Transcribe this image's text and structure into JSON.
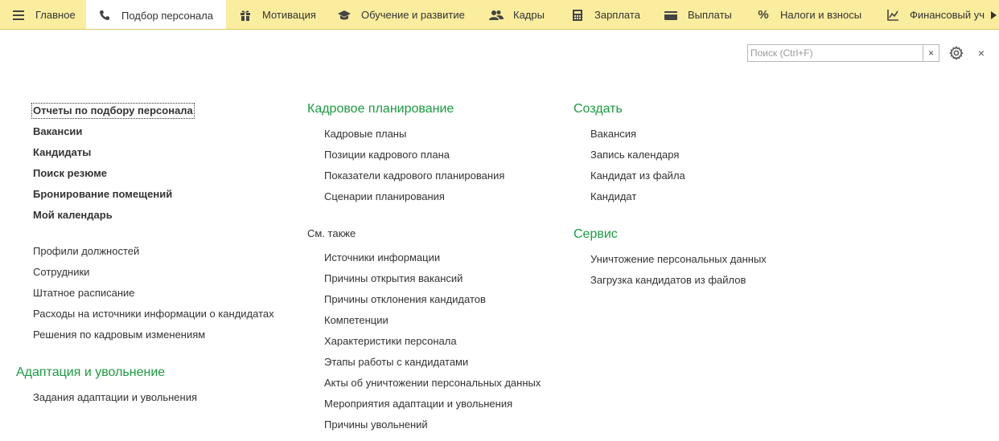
{
  "tabs": [
    {
      "label": "Главное",
      "icon": "hamburger-icon"
    },
    {
      "label": "Подбор персонала",
      "icon": "phone-icon"
    },
    {
      "label": "Мотивация",
      "icon": "gift-icon"
    },
    {
      "label": "Обучение и развитие",
      "icon": "graduation-cap-icon"
    },
    {
      "label": "Кадры",
      "icon": "people-icon"
    },
    {
      "label": "Зарплата",
      "icon": "calculator-icon"
    },
    {
      "label": "Выплаты",
      "icon": "wallet-icon"
    },
    {
      "label": "Налоги и взносы",
      "icon": "percent-icon"
    },
    {
      "label": "Финансовый уч",
      "icon": "chart-axis-icon"
    }
  ],
  "search": {
    "placeholder": "Поиск (Ctrl+F)",
    "value": "",
    "clear_glyph": "×"
  },
  "window": {
    "close_glyph": "×"
  },
  "left": {
    "bold_links": [
      "Отчеты по подбору персонала",
      "Вакансии",
      "Кандидаты",
      "Поиск резюме",
      "Бронирование помещений",
      "Мой календарь"
    ],
    "links": [
      "Профили должностей",
      "Сотрудники",
      "Штатное расписание",
      "Расходы на источники информации о кандидатах",
      "Решения по кадровым изменениям"
    ],
    "adaptation": {
      "title": "Адаптация и увольнение",
      "links": [
        "Задания адаптации и увольнения"
      ]
    }
  },
  "middle": {
    "planning": {
      "title": "Кадровое планирование",
      "links": [
        "Кадровые планы",
        "Позиции кадрового плана",
        "Показатели кадрового планирования",
        "Сценарии планирования"
      ]
    },
    "see_also": {
      "title": "См. также",
      "links": [
        "Источники информации",
        "Причины открытия вакансий",
        "Причины отклонения кандидатов",
        "Компетенции",
        "Характеристики персонала",
        "Этапы работы с кандидатами",
        "Акты об уничтожении персональных данных",
        "Мероприятия адаптации и увольнения",
        "Причины увольнений"
      ]
    }
  },
  "right": {
    "create": {
      "title": "Создать",
      "links": [
        "Вакансия",
        "Запись календаря",
        "Кандидат из файла",
        "Кандидат"
      ]
    },
    "service": {
      "title": "Сервис",
      "links": [
        "Уничтожение персональных данных",
        "Загрузка кандидатов из файлов"
      ]
    }
  },
  "colors": {
    "accent_green": "#1a9c3f",
    "topbar": "#fbed9e",
    "text": "#333333"
  }
}
